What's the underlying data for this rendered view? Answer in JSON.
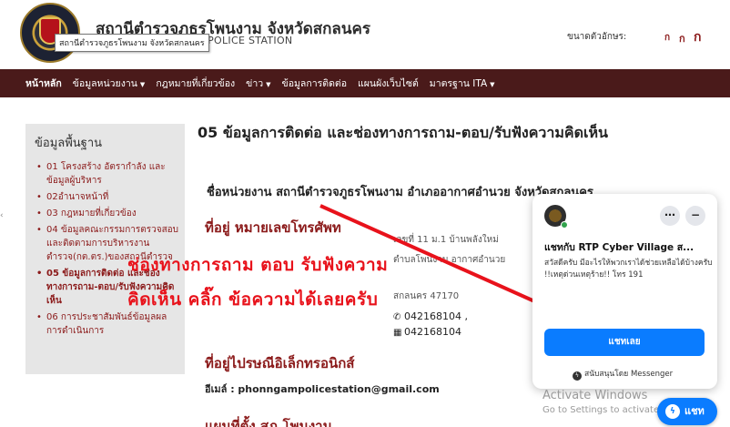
{
  "header": {
    "title": "สถานีตำรวจภูธรโพนงาม จังหวัดสกลนคร",
    "subtitle": "NCIAL POLICE STATION",
    "tooltip": "สถานีตำรวจภูธรโพนงาม จังหวัดสกลนคร",
    "font_size_label": "ขนาดตัวอักษร:",
    "font_sizes": [
      "ก",
      "ก",
      "ก"
    ]
  },
  "nav": {
    "items": [
      {
        "label": "หน้าหลัก"
      },
      {
        "label": "ข้อมูลหน่วยงาน"
      },
      {
        "label": "กฎหมายที่เกี่ยวข้อง"
      },
      {
        "label": "ข่าว"
      },
      {
        "label": "ข้อมูลการติดต่อ"
      },
      {
        "label": "แผนผังเว็บไซต์"
      },
      {
        "label": "มาตรฐาน ITA"
      }
    ]
  },
  "sidebar": {
    "title": "ข้อมูลพื้นฐาน",
    "items": [
      {
        "label": "01 โครงสร้าง อัตรากำลัง และข้อมูลผู้บริหาร"
      },
      {
        "label": "02อำนาจหน้าที่"
      },
      {
        "label": "03 กฎหมายที่เกี่ยวข้อง"
      },
      {
        "label": "04 ข้อมูลคณะกรรมการตรวจสอบและติดตามการบริหารงานตำรวจ(กต.ตร.)ของสถานีตำรวจ"
      },
      {
        "label": "05 ข้อมูลการติดต่อ และช่องทางการถาม-ตอบ/รับฟังความคิดเห็น"
      },
      {
        "label": "06 การประชาสัมพันธ์ข้อมูลผลการดำเนินการ"
      }
    ]
  },
  "main": {
    "heading": "05 ข้อมูลการติดต่อ และช่องทางการถาม-ตอบ/รับฟังความคิดเห็น",
    "unit_name": "ชื่อหน่วยงาน สถานีตำรวจภูธรโพนงาม อำเภออากาศอำนวย จังหวัดสกลนคร",
    "address_title": "ที่อยู่ หมายเลขโทรศัพท",
    "address_lines": [
      "เลขที่ 11 ม.1 บ้านพลังใหม่",
      "ตำบลโพนงาม อากาศอำนวย",
      "สกลนคร 47170"
    ],
    "phone": "042168104 ,",
    "fax": "042168104",
    "email_title": "ที่อยู่ไปรษณีอิเล็กทรอนิกส์",
    "email_line": "อีเมล์ : phonngampolicestation@gmail.com",
    "map_title": "แผนที่ตั้ง สภ.โพนงาม"
  },
  "overlay": {
    "line1": "ช่องทางการถาม  ตอบ รับฟังความ",
    "line2": "คิดเห็น  คลิ๊ก ข้อความได้เลยครับ",
    "color": "#e8121b"
  },
  "chat": {
    "name": "แชทกับ RTP Cyber Village ส...",
    "greeting": "สวัสดีครับ มีอะไรให้พวกเราได้ช่วยเหลือได้บ้างครับ !!เหตุด่วนเหตุร้าย!! โทร 191",
    "button": "แชทเลย",
    "footer": "สนับสนุนโดย Messenger",
    "pill_label": "แชท",
    "accent": "#0a7cff"
  },
  "watermark": {
    "line1": "Activate Windows",
    "line2": "Go to Settings to activate Windows."
  }
}
